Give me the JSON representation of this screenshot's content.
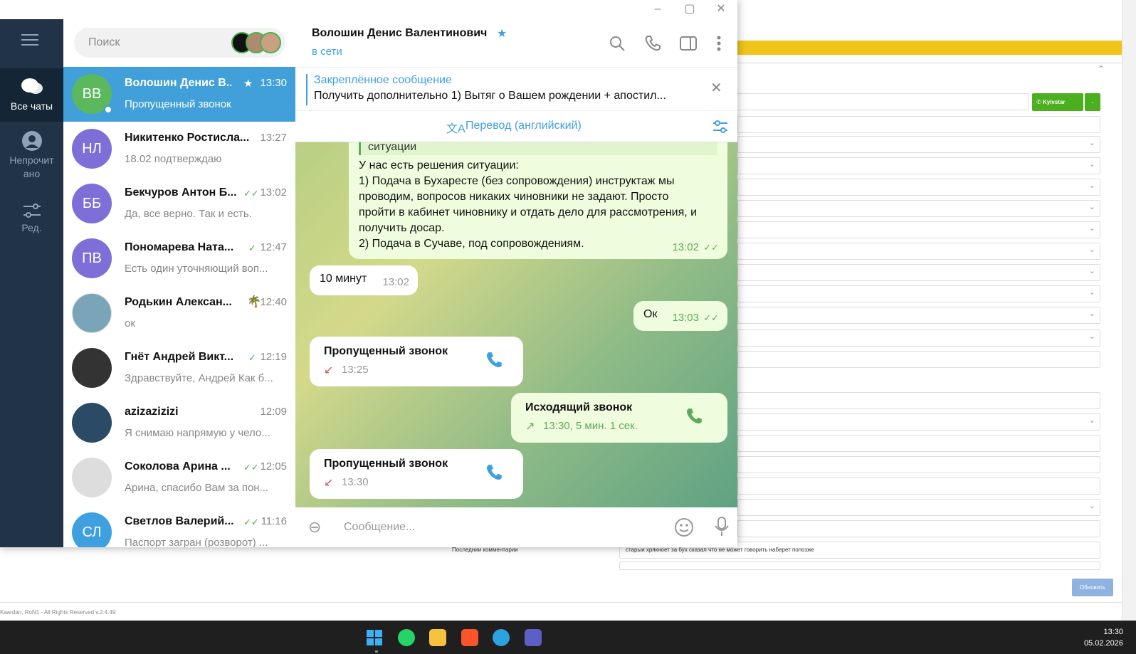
{
  "crm": {
    "kyivstar_label": "Kyivstar",
    "last_comment_label": "Последнии комментарии",
    "last_comment_value": "старыи хрякноет за бух сказал что не может говорить наберет попозже",
    "update_button": "Обновить",
    "footer": "Kaardan, RoN1 - All Rights Reserved v.2.4.49"
  },
  "taskbar": {
    "time": "13:30",
    "date": "05.02.2026"
  },
  "rail": {
    "all_chats": "Все чаты",
    "unread_1": "Непрочит",
    "unread_2": "ано",
    "edit": "Ред."
  },
  "search": {
    "placeholder": "Поиск"
  },
  "chats": [
    {
      "initials": "ВВ",
      "name": "Волошин Денис В...",
      "time": "13:30",
      "msg": "Пропущенный звонок",
      "color": "#5cb85c"
    },
    {
      "initials": "НЛ",
      "name": "Никитенко Ростисла...",
      "time": "13:27",
      "msg": "18.02 подтверждаю",
      "color": "#7e6fd8"
    },
    {
      "initials": "ББ",
      "name": "Бекчуров Антон Б...",
      "time": "13:02",
      "msg": "Да, все верно. Так и есть.",
      "color": "#7e6fd8"
    },
    {
      "initials": "ПВ",
      "name": "Пономарева Ната...",
      "time": "12:47",
      "msg": "Есть один уточняющий воп...",
      "color": "#7e6fd8"
    },
    {
      "initials": "",
      "name": "Родькин Алексан...",
      "time": "12:40",
      "msg": "ок",
      "color": "#7aa5b8"
    },
    {
      "initials": "",
      "name": "Гнёт Андрей Викт...",
      "time": "12:19",
      "msg": "Здравствуйте, Андрей Как б...",
      "color": "#333"
    },
    {
      "initials": "",
      "name": "azizazizizi",
      "time": "12:09",
      "msg": "Я снимаю напрямую у чело...",
      "color": "#2a4a66"
    },
    {
      "initials": "",
      "name": "Соколова Арина ...",
      "time": "12:05",
      "msg": "Арина, спасибо Вам за пон...",
      "color": "#ddd"
    },
    {
      "initials": "СЛ",
      "name": "Светлов Валерий...",
      "time": "11:16",
      "msg": "Паспорт загран (розворот) ...",
      "color": "#3fa0e0"
    }
  ],
  "header": {
    "name": "Волошин Денис Валентинович",
    "status": "в сети"
  },
  "pinned": {
    "title": "Закреплённое сообщение",
    "text": "Получить дополнительно  1) Вытяг о Вашем рождении + апостил..."
  },
  "translate": {
    "label": "Перевод (английский)"
  },
  "messages": {
    "m1_cut": "ситуации",
    "m1_l1": "У нас есть решения ситуации:",
    "m1_l2": "1) Подача в Бухаресте (без сопровождения) инструктаж мы",
    "m1_l3": "проводим, вопросов никаких чиновники не задают. Просто",
    "m1_l4": "пройти в кабинет чиновнику и отдать дело для рассмотрения, и",
    "m1_l5": "получить досар.",
    "m1_l6": "2) Подача в Сучаве, под сопровождениям.",
    "m1_time": "13:02",
    "m2_text": "10 минут",
    "m2_time": "13:02",
    "m3_text": "Ок",
    "m3_time": "13:03",
    "call1_title": "Пропущенный звонок",
    "call1_time": "13:25",
    "call2_title": "Исходящий звонок",
    "call2_time": "13:30, 5 мин. 1 сек.",
    "call3_title": "Пропущенный звонок",
    "call3_time": "13:30"
  },
  "composer": {
    "placeholder": "Сообщение..."
  }
}
